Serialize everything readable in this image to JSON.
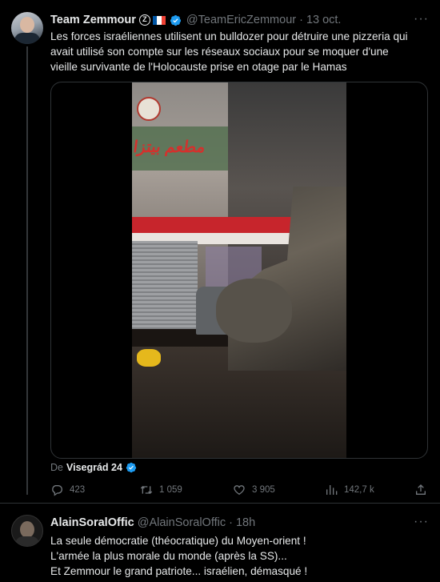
{
  "tweet": {
    "author_name": "Team Zemmour",
    "z_badge": "Z",
    "handle": "@TeamEricZemmour",
    "separator": "·",
    "date": "13 oct.",
    "more_label": "···",
    "text_lines": [
      "Les forces israéliennes utilisent un bulldozer pour détruire une pizzeria qui",
      "avait utilisé son compte sur les réseaux sociaux pour se moquer d'une",
      "vieille survivante de l'Holocauste prise en otage par le Hamas"
    ],
    "video_sign_text": "ﻣﻄﻌﻢ ﺑﻴﺘﺰﺍ",
    "source_prefix": "De",
    "source_name": "Visegrád 24",
    "actions": {
      "replies": "423",
      "reposts": "1 059",
      "likes": "3 905",
      "views": "142,7 k"
    },
    "icons": {
      "reply": "reply-icon",
      "repost": "repost-icon",
      "like": "heart-icon",
      "views": "views-icon",
      "share": "share-icon",
      "verified": "verified-badge-icon"
    },
    "colors": {
      "verified": "#1d9bf0",
      "flag_blue": "#0055a4",
      "flag_white": "#ffffff",
      "flag_red": "#ef4135"
    }
  },
  "reply": {
    "author_name": "AlainSoralOffic",
    "handle": "@AlainSoralOffic",
    "separator": "·",
    "time": "18h",
    "more_label": "···",
    "text_lines": [
      "La seule démocratie (théocratique) du Moyen-orient !",
      "L'armée la plus morale du monde (après la SS)...",
      "Et Zemmour le grand patriote... israélien, démasqué !"
    ]
  }
}
